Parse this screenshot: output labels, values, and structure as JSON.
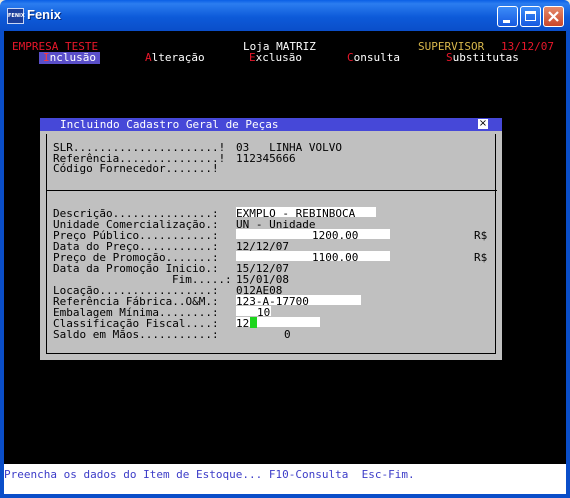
{
  "window": {
    "title": "Fenix",
    "icon_text": "FENIX"
  },
  "header": {
    "company": "EMPRESA TESTE",
    "store": "Loja MATRIZ",
    "role": "SUPERVISOR",
    "date": "13/12/07"
  },
  "menu": [
    {
      "hot": "I",
      "rest": "nclusão"
    },
    {
      "hot": "A",
      "rest": "lteração"
    },
    {
      "hot": "E",
      "rest": "xclusão"
    },
    {
      "hot": "C",
      "rest": "onsulta"
    },
    {
      "hot": "S",
      "rest": "ubstitutas"
    }
  ],
  "dialog": {
    "title": "Incluindo Cadastro Geral de Peças",
    "close": "×",
    "slr_label": "SLR......................!",
    "slr_value": "03   LINHA VOLVO",
    "ref_label": "Referência...............!",
    "ref_value": "112345666",
    "codforn_label": "Código Fornecedor.......!",
    "descricao_label": "Descrição...............:",
    "descricao_value": "EXMPLO - REBINBOCA",
    "unidade_label": "Unidade Comercialização.:",
    "unidade_value": "UN - Unidade",
    "preco_publico_label": "Preço Público...........:",
    "preco_publico_value": "1200.00",
    "currency1": "R$",
    "data_preco_label": "Data do Preço...........:",
    "data_preco_value": "12/12/07",
    "preco_promo_label": "Preço de Promoção.......:",
    "preco_promo_value": "1100.00",
    "currency2": "R$",
    "data_promo_inicio_label": "Data da Promoção Inicio.:",
    "data_promo_inicio_value": "15/12/07",
    "fim_label": "Fim.....:",
    "fim_value": "15/01/08",
    "locacao_label": "Locação.................:",
    "locacao_value": "012AE08",
    "ref_fabrica_label": "Referência Fábrica..O&M.:",
    "ref_fabrica_value": "123-A-17700",
    "embalagem_label": "Embalagem Mínima........:",
    "embalagem_value": "10",
    "classificacao_label": "Classificação Fiscal....:",
    "classificacao_value": "12",
    "saldo_label": "Saldo em Mãos...........:",
    "saldo_value": "0"
  },
  "status_bar": "Preencha os dados do Item de Estoque... F10-Consulta  Esc-Fim."
}
